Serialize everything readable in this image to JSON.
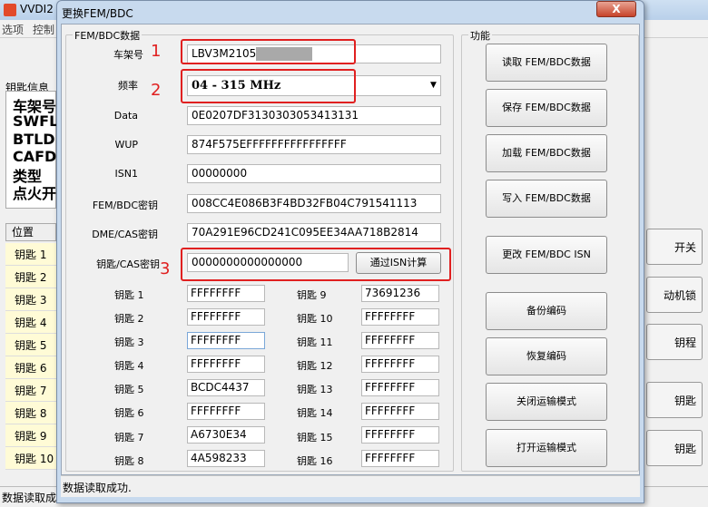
{
  "app": {
    "title": "VVDI2 -",
    "menu": [
      "选项",
      "控制"
    ],
    "keyinfo_label": "钥匙信息",
    "keyinfo_lines": [
      "车架号",
      "SWFL",
      "BTLD",
      "CAFD",
      "类型",
      "点火开"
    ],
    "position_header": "位置",
    "key_list": [
      "钥匙 1",
      "钥匙 2",
      "钥匙 3",
      "钥匙 4",
      "钥匙 5",
      "钥匙 6",
      "钥匙 7",
      "钥匙 8",
      "钥匙 9",
      "钥匙 10"
    ],
    "status": "数据读取成功",
    "right_buttons": [
      "开关",
      "动机锁",
      "钥程",
      "钥匙",
      "钥匙"
    ]
  },
  "dialog": {
    "title": "更换FEM/BDC",
    "close_label": "X",
    "group_data_label": "FEM/BDC数据",
    "group_func_label": "功能",
    "fields": {
      "vin_label": "车架号",
      "vin_value": "LBV3M2105",
      "freq_label": "频率",
      "freq_value": "04 - 315 MHz",
      "data_label": "Data",
      "data_value": "0E0207DF3130303053413131",
      "wup_label": "WUP",
      "wup_value": "874F575EFFFFFFFFFFFFFFFF",
      "isn1_label": "ISN1",
      "isn1_value": "00000000",
      "fem_key_label": "FEM/BDC密钥",
      "fem_key_value": "008CC4E086B3F4BD32FB04C791541113",
      "dme_key_label": "DME/CAS密钥",
      "dme_key_value": "70A291E96CD241C095EE34AA718B2814",
      "key_cas_label": "钥匙/CAS密钥",
      "key_cas_value": "0000000000000000",
      "calc_button": "通过ISN计算"
    },
    "keys_left": [
      {
        "label": "钥匙 1",
        "value": "FFFFFFFF"
      },
      {
        "label": "钥匙 2",
        "value": "FFFFFFFF"
      },
      {
        "label": "钥匙 3",
        "value": "FFFFFFFF"
      },
      {
        "label": "钥匙 4",
        "value": "FFFFFFFF"
      },
      {
        "label": "钥匙 5",
        "value": "BCDC4437"
      },
      {
        "label": "钥匙 6",
        "value": "FFFFFFFF"
      },
      {
        "label": "钥匙 7",
        "value": "A6730E34"
      },
      {
        "label": "钥匙 8",
        "value": "4A598233"
      }
    ],
    "keys_right": [
      {
        "label": "钥匙 9",
        "value": "73691236"
      },
      {
        "label": "钥匙 10",
        "value": "FFFFFFFF"
      },
      {
        "label": "钥匙 11",
        "value": "FFFFFFFF"
      },
      {
        "label": "钥匙 12",
        "value": "FFFFFFFF"
      },
      {
        "label": "钥匙 13",
        "value": "FFFFFFFF"
      },
      {
        "label": "钥匙 14",
        "value": "FFFFFFFF"
      },
      {
        "label": "钥匙 15",
        "value": "FFFFFFFF"
      },
      {
        "label": "钥匙 16",
        "value": "FFFFFFFF"
      }
    ],
    "func_buttons": [
      "读取 FEM/BDC数据",
      "保存 FEM/BDC数据",
      "加载 FEM/BDC数据",
      "写入 FEM/BDC数据",
      "更改 FEM/BDC ISN",
      "备份编码",
      "恢复编码",
      "关闭运输模式",
      "打开运输模式"
    ],
    "status": "数据读取成功.",
    "annotations": [
      "1",
      "2",
      "3"
    ],
    "annotation_color": "#e02020"
  }
}
